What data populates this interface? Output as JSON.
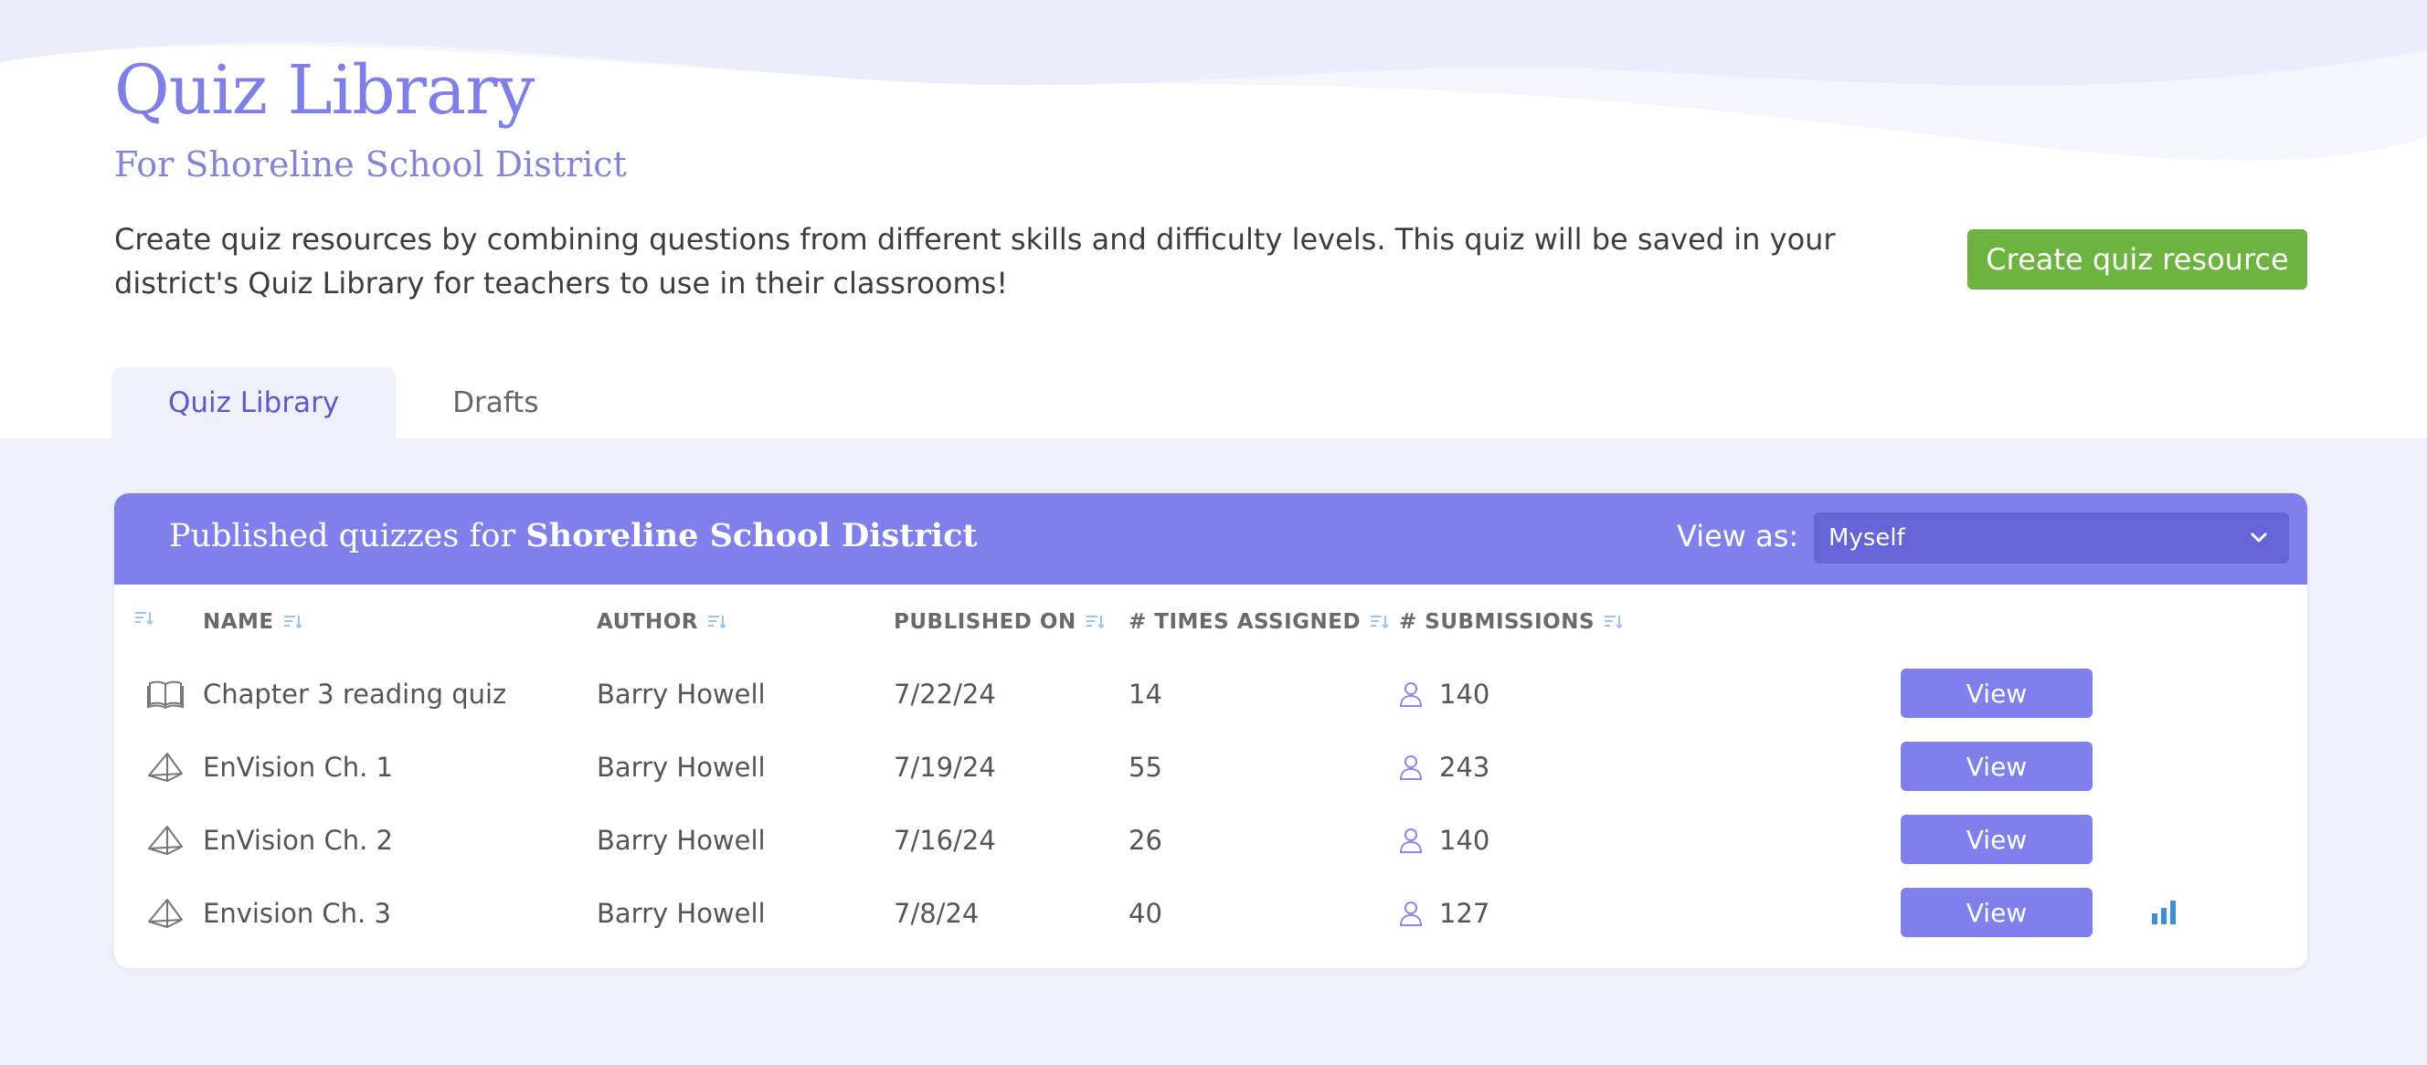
{
  "header": {
    "title": "Quiz Library",
    "subtitle": "For Shoreline School District",
    "description": "Create quiz resources by combining questions from different skills and difficulty levels. This quiz will be saved in your district's Quiz Library for teachers to use in their classrooms!",
    "create_button": "Create quiz resource"
  },
  "tabs": [
    {
      "label": "Quiz Library",
      "active": true
    },
    {
      "label": "Drafts",
      "active": false
    }
  ],
  "panel": {
    "title_prefix": "Published quizzes for ",
    "title_district": "Shoreline School District",
    "view_as_label": "View as:",
    "view_as_value": "Myself"
  },
  "table": {
    "headers": {
      "name": "NAME",
      "author": "AUTHOR",
      "published_on": "PUBLISHED ON",
      "times_assigned": "# TIMES ASSIGNED",
      "submissions": "# SUBMISSIONS"
    },
    "view_label": "View",
    "rows": [
      {
        "icon": "book-icon",
        "name": "Chapter 3 reading quiz",
        "author": "Barry Howell",
        "published_on": "7/22/24",
        "times_assigned": "14",
        "submissions": "140",
        "stats": false
      },
      {
        "icon": "pyramid-icon",
        "name": "EnVision Ch. 1",
        "author": "Barry Howell",
        "published_on": "7/19/24",
        "times_assigned": "55",
        "submissions": "243",
        "stats": false
      },
      {
        "icon": "pyramid-icon",
        "name": "EnVision Ch. 2",
        "author": "Barry Howell",
        "published_on": "7/16/24",
        "times_assigned": "26",
        "submissions": "140",
        "stats": false
      },
      {
        "icon": "pyramid-icon",
        "name": "Envision Ch. 3",
        "author": "Barry Howell",
        "published_on": "7/8/24",
        "times_assigned": "40",
        "submissions": "127",
        "stats": true
      }
    ]
  },
  "colors": {
    "accent": "#8080ec",
    "accent_dark": "#6565d8",
    "create_green": "#6db33f",
    "background": "#f0f0fb",
    "stats_blue": "#3d8fd6"
  }
}
